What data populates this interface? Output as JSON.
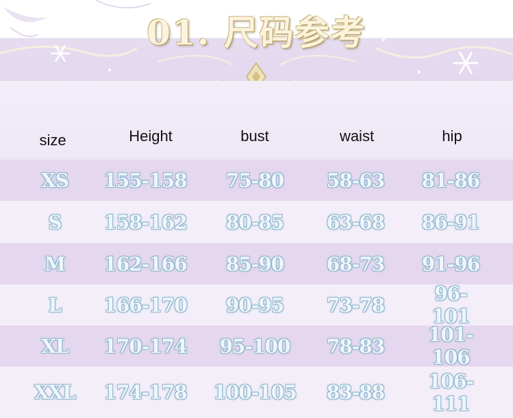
{
  "title": "01. 尺码参考",
  "table": {
    "headers": [
      "size",
      "Height",
      "bust",
      "waist",
      "hip"
    ],
    "rows": [
      [
        "XS",
        "155-158",
        "75-80",
        "58-63",
        "81-86"
      ],
      [
        "S",
        "158-162",
        "80-85",
        "63-68",
        "86-91"
      ],
      [
        "M",
        "162-166",
        "85-90",
        "68-73",
        "91-96"
      ],
      [
        "L",
        "166-170",
        "90-95",
        "73-78",
        "96-101"
      ],
      [
        "XL",
        "170-174",
        "95-100",
        "78-83",
        "101-106"
      ],
      [
        "XXL",
        "174-178",
        "100-105",
        "83-88",
        "106-111"
      ]
    ]
  },
  "colors": {
    "band_dark": "#e5d7ef",
    "band_light": "#f4eef9",
    "gold": "#d8c48e",
    "data_text": "#eef6fb",
    "data_outline": "#8fb4cc"
  },
  "icons": [
    "snowflake-icon",
    "gold-diamond-ornament-icon",
    "feather-icon"
  ]
}
